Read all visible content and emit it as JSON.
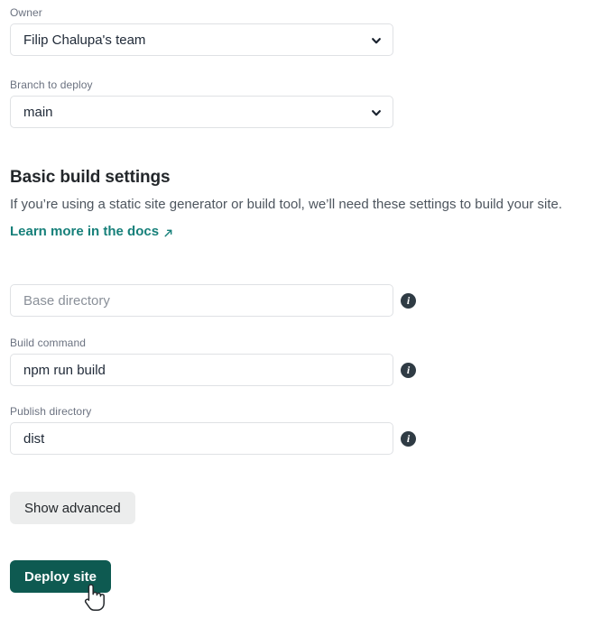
{
  "form": {
    "owner": {
      "label": "Owner",
      "value": "Filip Chalupa's team",
      "chevron_icon": "chevron-down-icon"
    },
    "branch": {
      "label": "Branch to deploy",
      "value": "main",
      "chevron_icon": "chevron-down-icon"
    }
  },
  "build_section": {
    "title": "Basic build settings",
    "description": "If you’re using a static site generator or build tool, we’ll need these settings to build your site.",
    "link_label": "Learn more in the docs",
    "link_icon": "external-link-arrow-icon",
    "fields": {
      "base_directory": {
        "label": "",
        "placeholder": "Base directory",
        "value": "",
        "info_icon": "info-icon"
      },
      "build_command": {
        "label": "Build command",
        "placeholder": "",
        "value": "npm run build",
        "info_icon": "info-icon"
      },
      "publish_directory": {
        "label": "Publish directory",
        "placeholder": "",
        "value": "dist",
        "info_icon": "info-icon"
      }
    }
  },
  "actions": {
    "show_advanced_label": "Show advanced",
    "deploy_label": "Deploy site"
  },
  "colors": {
    "primary_button_bg": "#0e5a51",
    "secondary_button_bg": "#eceded",
    "link_teal": "#17807a",
    "info_icon_bg": "#2f3b44",
    "field_border": "#dfe1e4",
    "label_gray": "#6b7280",
    "text_dark": "#23272b",
    "placeholder_gray": "#8a9099",
    "page_bg": "#ffffff"
  },
  "cursor": {
    "icon": "pointing-hand-cursor"
  }
}
